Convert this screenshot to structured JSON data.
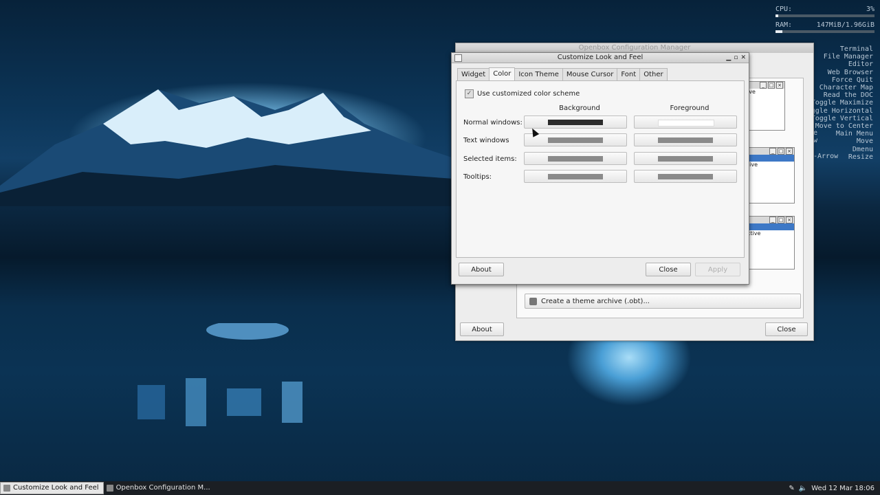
{
  "conky": {
    "cpu_label": "CPU:",
    "cpu_value": "3%",
    "cpu_fraction": 0.03,
    "ram_label": "RAM:",
    "ram_value": "147MiB/1.96GiB",
    "ram_fraction": 0.07
  },
  "desktop_menu": [
    "Terminal",
    "File Manager",
    "Editor",
    "Web Browser",
    "Force Quit",
    "Character Map",
    "Read the DOC",
    "Toggle Maximize",
    "Toggle Horizontal",
    "Toggle Vertical",
    "Move to Center",
    "Main Menu",
    "Move",
    "Dmenu",
    "Resize"
  ],
  "menu_keys": {
    "w": "w",
    "arrow": "-Arrow",
    "e": "e"
  },
  "back_window": {
    "title": "Openbox Configuration Manager",
    "thumb_labels": [
      "ive",
      "tive",
      "ctive"
    ],
    "archive_label": "Create a theme archive (.obt)...",
    "about_label": "About",
    "close_label": "Close"
  },
  "front_window": {
    "title": "Customize Look and Feel",
    "tabs": [
      "Widget",
      "Color",
      "Icon Theme",
      "Mouse Cursor",
      "Font",
      "Other"
    ],
    "active_tab": "Color",
    "use_custom_label": "Use customized color scheme",
    "use_custom_checked": "✓",
    "col_background": "Background",
    "col_foreground": "Foreground",
    "rows": [
      {
        "label": "Normal windows:",
        "bg_color": "#2b2b2b",
        "fg_color": "#ffffff"
      },
      {
        "label": "Text windows",
        "bg_color": "#8a8a8a",
        "fg_color": "#8a8a8a"
      },
      {
        "label": "Selected items:",
        "bg_color": "#8a8a8a",
        "fg_color": "#8a8a8a"
      },
      {
        "label": "Tooltips:",
        "bg_color": "#8a8a8a",
        "fg_color": "#8a8a8a"
      }
    ],
    "about_label": "About",
    "close_label": "Close",
    "apply_label": "Apply"
  },
  "taskbar": {
    "tasks": [
      "Customize Look and Feel",
      "Openbox Configuration M..."
    ],
    "clock": "Wed 12 Mar 18:06"
  }
}
